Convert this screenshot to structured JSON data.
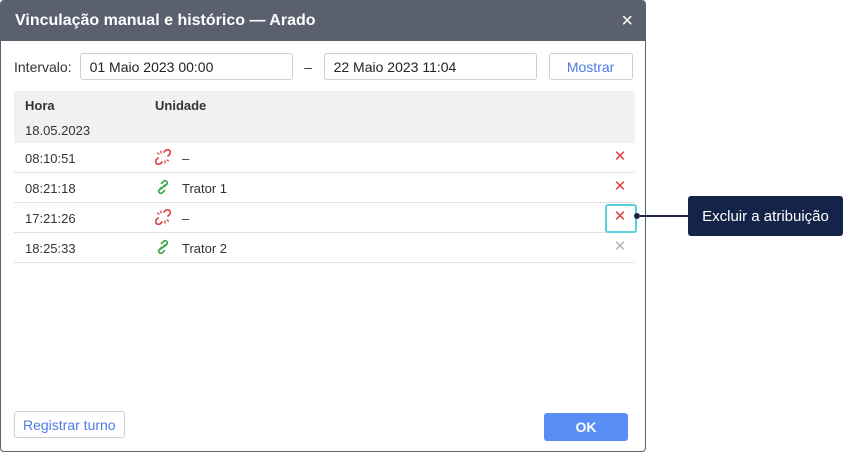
{
  "dialog": {
    "title": "Vinculação manual e histórico — Arado",
    "close_icon": "×"
  },
  "interval": {
    "label": "Intervalo:",
    "from": "01 Maio 2023 00:00",
    "separator": "–",
    "to": "22 Maio 2023 11:04",
    "show_button": "Mostrar"
  },
  "table": {
    "columns": [
      "Hora",
      "Unidade"
    ],
    "group_date": "18.05.2023",
    "rows": [
      {
        "time": "08:10:51",
        "icon": "unlink-icon",
        "unit": "–"
      },
      {
        "time": "08:21:18",
        "icon": "link-icon",
        "unit": "Trator 1"
      },
      {
        "time": "17:21:26",
        "icon": "unlink-icon",
        "unit": "–"
      },
      {
        "time": "18:25:33",
        "icon": "link-icon",
        "unit": "Trator 2"
      }
    ]
  },
  "footer": {
    "register_shift": "Registrar turno",
    "ok": "OK"
  },
  "callout": {
    "text": "Excluir a atribuição"
  },
  "colors": {
    "titlebar": "#5a606e",
    "accent": "#5b8ef5",
    "delete": "#e04040",
    "callout": "#142448"
  }
}
